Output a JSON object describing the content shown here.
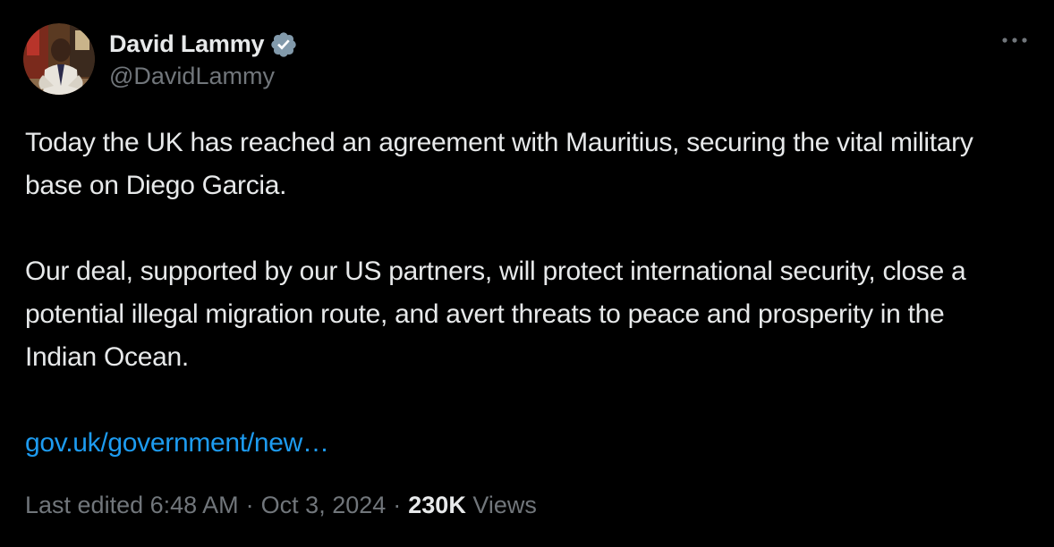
{
  "author": {
    "display_name": "David Lammy",
    "handle": "@DavidLammy",
    "verified": true,
    "verified_color": "#829aab"
  },
  "tweet": {
    "paragraphs": [
      "Today the UK has reached an agreement with Mauritius, securing the vital military base on Diego Garcia.",
      "Our deal, supported by our US partners, will protect international security, close a potential illegal migration route, and avert threats to peace and prosperity in the Indian Ocean."
    ],
    "link_text": "gov.uk/government/new…"
  },
  "meta": {
    "edited_label": "Last edited 6:48 AM",
    "separator": "·",
    "date": "Oct 3, 2024",
    "views_count": "230K",
    "views_label": "Views"
  },
  "icons": {
    "more": "more-horizontal-icon",
    "verified": "verified-badge-icon"
  },
  "colors": {
    "background": "#000000",
    "text": "#e7e9ea",
    "secondary": "#71767b",
    "link": "#1d9bf0"
  }
}
